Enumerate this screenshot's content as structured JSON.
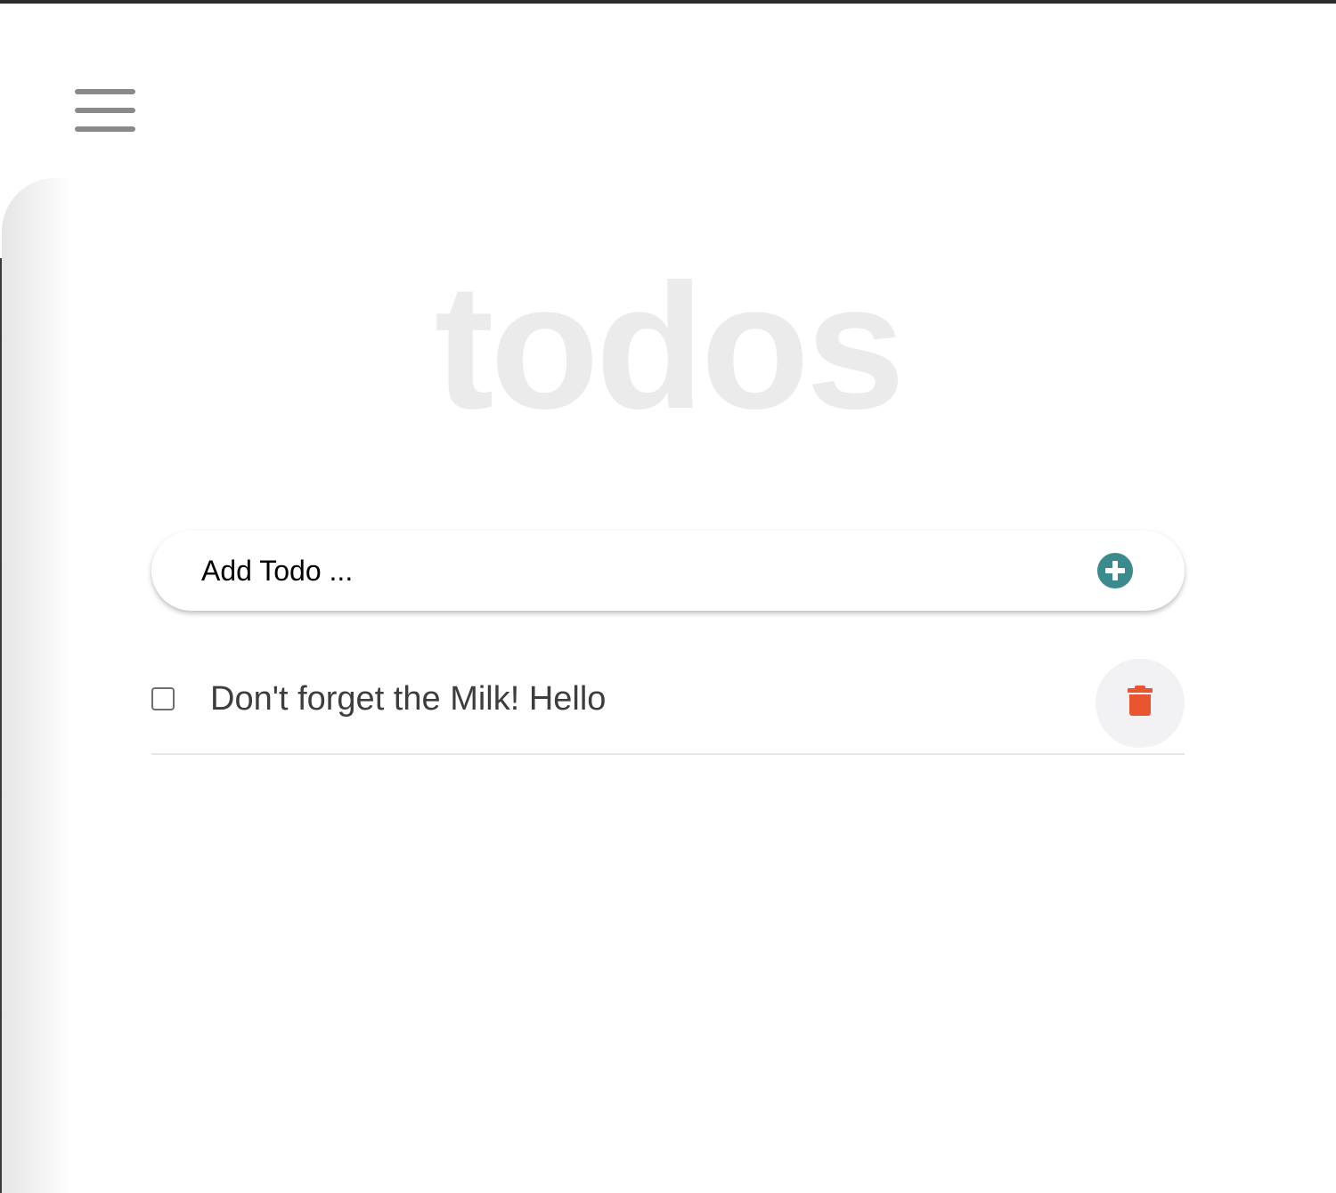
{
  "app": {
    "title": "todos",
    "accent_color": "#3b8a8c",
    "danger_color": "#e8552e"
  },
  "header": {
    "menu_icon": "hamburger-menu-icon"
  },
  "add_todo": {
    "placeholder": "Add Todo ...",
    "value": "",
    "add_icon": "plus-circle-icon"
  },
  "todos": [
    {
      "text": "Don't forget the Milk! Hello",
      "completed": false,
      "delete_icon": "trash-icon"
    }
  ]
}
